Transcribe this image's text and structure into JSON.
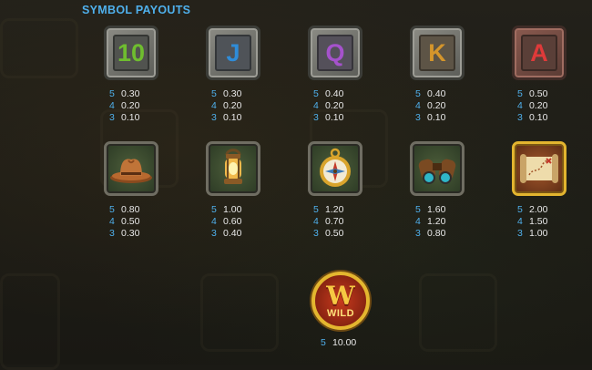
{
  "title": "SYMBOL PAYOUTS",
  "symbols": [
    {
      "label": "10",
      "icon": "ten-card-icon",
      "color": "#6fbd2f",
      "bg": "#51534f",
      "payouts": [
        {
          "count": "5",
          "value": "0.30"
        },
        {
          "count": "4",
          "value": "0.20"
        },
        {
          "count": "3",
          "value": "0.10"
        }
      ]
    },
    {
      "label": "J",
      "icon": "jack-card-icon",
      "color": "#2f8cd8",
      "bg": "#4f5358",
      "payouts": [
        {
          "count": "5",
          "value": "0.30"
        },
        {
          "count": "4",
          "value": "0.20"
        },
        {
          "count": "3",
          "value": "0.10"
        }
      ]
    },
    {
      "label": "Q",
      "icon": "queen-card-icon",
      "color": "#a552cc",
      "bg": "#54505a",
      "payouts": [
        {
          "count": "5",
          "value": "0.40"
        },
        {
          "count": "4",
          "value": "0.20"
        },
        {
          "count": "3",
          "value": "0.10"
        }
      ]
    },
    {
      "label": "K",
      "icon": "king-card-icon",
      "color": "#d4952b",
      "bg": "#5d5446",
      "payouts": [
        {
          "count": "5",
          "value": "0.40"
        },
        {
          "count": "4",
          "value": "0.20"
        },
        {
          "count": "3",
          "value": "0.10"
        }
      ]
    },
    {
      "label": "A",
      "icon": "ace-card-icon",
      "color": "#df3a3a",
      "bg": "#5a3f38",
      "payouts": [
        {
          "count": "5",
          "value": "0.50"
        },
        {
          "count": "4",
          "value": "0.20"
        },
        {
          "count": "3",
          "value": "0.10"
        }
      ]
    },
    {
      "icon": "cowboy-hat-icon",
      "payouts": [
        {
          "count": "5",
          "value": "0.80"
        },
        {
          "count": "4",
          "value": "0.50"
        },
        {
          "count": "3",
          "value": "0.30"
        }
      ]
    },
    {
      "icon": "lantern-icon",
      "payouts": [
        {
          "count": "5",
          "value": "1.00"
        },
        {
          "count": "4",
          "value": "0.60"
        },
        {
          "count": "3",
          "value": "0.40"
        }
      ]
    },
    {
      "icon": "compass-icon",
      "payouts": [
        {
          "count": "5",
          "value": "1.20"
        },
        {
          "count": "4",
          "value": "0.70"
        },
        {
          "count": "3",
          "value": "0.50"
        }
      ]
    },
    {
      "icon": "binoculars-icon",
      "payouts": [
        {
          "count": "5",
          "value": "1.60"
        },
        {
          "count": "4",
          "value": "1.20"
        },
        {
          "count": "3",
          "value": "0.80"
        }
      ]
    },
    {
      "icon": "treasure-map-icon",
      "payouts": [
        {
          "count": "5",
          "value": "2.00"
        },
        {
          "count": "4",
          "value": "1.50"
        },
        {
          "count": "3",
          "value": "1.00"
        }
      ]
    }
  ],
  "wild": {
    "icon": "wild-symbol-icon",
    "letter": "W",
    "text": "WILD",
    "payouts": [
      {
        "count": "5",
        "value": "10.00"
      }
    ]
  },
  "colors": {
    "accent": "#4fb0ec",
    "value_text": "#e8e8e8",
    "gold": "#e4b62f"
  }
}
